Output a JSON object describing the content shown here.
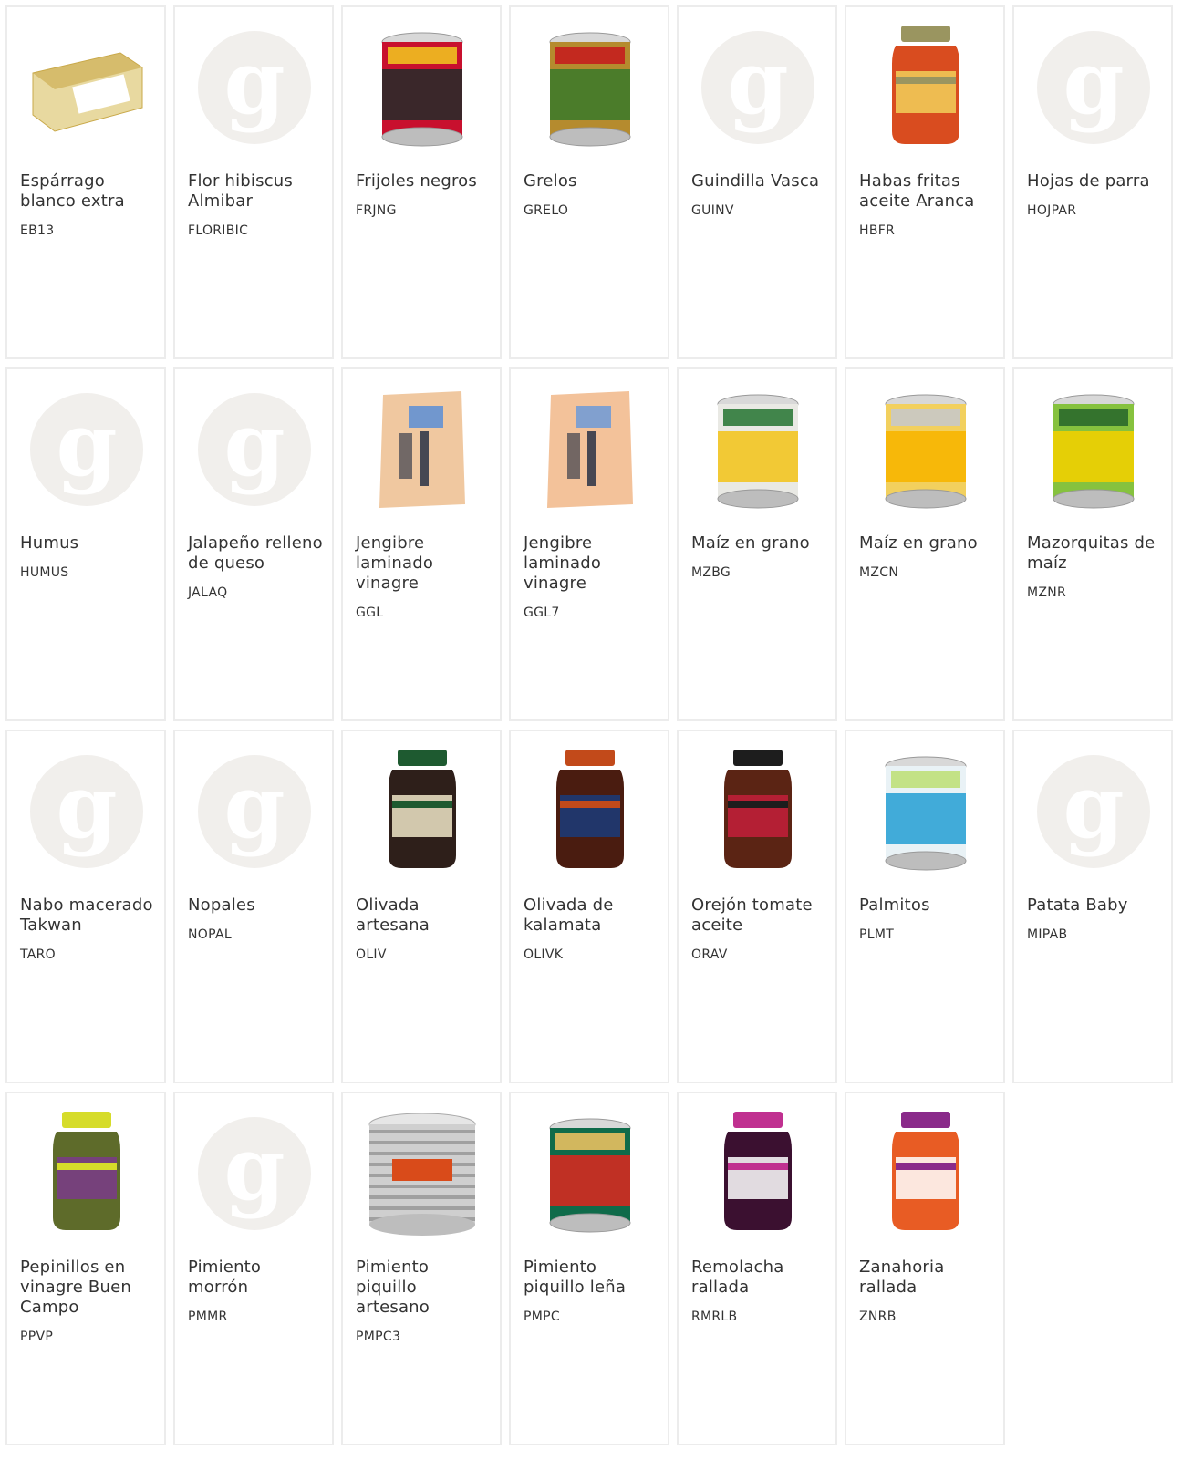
{
  "products": [
    {
      "name": "Espárrago blanco extra",
      "code": "EB13",
      "image": "tin-asparagus",
      "colors": {
        "main": "#e8d9a0",
        "accent": "#c9a94a",
        "label": "#ffffff"
      }
    },
    {
      "name": "Flor hibiscus Almibar",
      "code": "FLORIBIC",
      "image": "placeholder"
    },
    {
      "name": "Frijoles negros",
      "code": "FRJNG",
      "image": "can-black-beans",
      "colors": {
        "main": "#c8102e",
        "accent": "#2a2a2a",
        "label": "#f0c020"
      }
    },
    {
      "name": "Grelos",
      "code": "GRELO",
      "image": "can-greens",
      "colors": {
        "main": "#b58b2e",
        "accent": "#3f7a2a",
        "label": "#c41e1e"
      }
    },
    {
      "name": "Guindilla Vasca",
      "code": "GUINV",
      "image": "placeholder"
    },
    {
      "name": "Habas fritas aceite Aranca",
      "code": "HBFR",
      "image": "jar-beans",
      "colors": {
        "main": "#d94c1f",
        "accent": "#9a9560",
        "label": "#f1d05a"
      }
    },
    {
      "name": "Hojas de parra",
      "code": "HOJPAR",
      "image": "placeholder"
    },
    {
      "name": "Humus",
      "code": "HUMUS",
      "image": "placeholder"
    },
    {
      "name": "Jalapeño relleno de queso",
      "code": "JALAQ",
      "image": "placeholder"
    },
    {
      "name": "Jengibre laminado vinagre",
      "code": "GGL",
      "image": "bag-ginger",
      "colors": {
        "main": "#f0c8a0",
        "accent": "#5b8ed6",
        "label": "#1c2840"
      }
    },
    {
      "name": "Jengibre laminado vinagre",
      "code": "GGL7",
      "image": "bag-ginger",
      "colors": {
        "main": "#f3c29a",
        "accent": "#6c9ad8",
        "label": "#1c2840"
      }
    },
    {
      "name": "Maíz en grano",
      "code": "MZBG",
      "image": "can-corn",
      "colors": {
        "main": "#e9e9e4",
        "accent": "#f3c521",
        "label": "#2f7a3a"
      }
    },
    {
      "name": "Maíz en grano",
      "code": "MZCN",
      "image": "can-corn",
      "colors": {
        "main": "#f2d05e",
        "accent": "#f7b500",
        "label": "#c8c8c8"
      }
    },
    {
      "name": "Mazorquitas de maíz",
      "code": "MZNR",
      "image": "can-baby-corn",
      "colors": {
        "main": "#86c23e",
        "accent": "#f0d000",
        "label": "#2b6a2b"
      }
    },
    {
      "name": "Nabo macerado Takwan",
      "code": "TARO",
      "image": "placeholder"
    },
    {
      "name": "Nopales",
      "code": "NOPAL",
      "image": "placeholder"
    },
    {
      "name": "Olivada artesana",
      "code": "OLIV",
      "image": "jar-olivada",
      "colors": {
        "main": "#2e1f1a",
        "accent": "#1e5a30",
        "label": "#efe6c8"
      }
    },
    {
      "name": "Olivada de kalamata",
      "code": "OLIVK",
      "image": "jar-olivada",
      "colors": {
        "main": "#4a1c10",
        "accent": "#c24a1a",
        "label": "#1a3b7a"
      }
    },
    {
      "name": "Orejón tomate aceite",
      "code": "ORAV",
      "image": "jar-tomato",
      "colors": {
        "main": "#5b2414",
        "accent": "#1d1d1d",
        "label": "#c41e3a"
      }
    },
    {
      "name": "Palmitos",
      "code": "PLMT",
      "image": "can-palm",
      "colors": {
        "main": "#e9f2f6",
        "accent": "#2fa3d6",
        "label": "#bfe07a"
      }
    },
    {
      "name": "Patata Baby",
      "code": "MIPAB",
      "image": "placeholder"
    },
    {
      "name": "Pepinillos en vinagre Buen Campo",
      "code": "PPVP",
      "image": "jar-pickles",
      "colors": {
        "main": "#5e6b2a",
        "accent": "#d6dc2a",
        "label": "#7a3a8a"
      }
    },
    {
      "name": "Pimiento morrón",
      "code": "PMMR",
      "image": "placeholder"
    },
    {
      "name": "Pimiento piquillo artesano",
      "code": "PMPC3",
      "image": "can-tin-plain",
      "colors": {
        "main": "#cfcfcf",
        "accent": "#a0a0a0",
        "label": "#d94b1a"
      }
    },
    {
      "name": "Pimiento piquillo leña",
      "code": "PMPC",
      "image": "can-peppers",
      "colors": {
        "main": "#0f6b4a",
        "accent": "#d42a20",
        "label": "#e8c060"
      }
    },
    {
      "name": "Remolacha rallada",
      "code": "RMRLB",
      "image": "jar-beet",
      "colors": {
        "main": "#3b1030",
        "accent": "#c03090",
        "label": "#ffffff"
      }
    },
    {
      "name": "Zanahoria rallada",
      "code": "ZNRB",
      "image": "jar-carrot",
      "colors": {
        "main": "#e85c24",
        "accent": "#8a2a8a",
        "label": "#ffffff"
      }
    }
  ],
  "placeholder_glyph": "g"
}
